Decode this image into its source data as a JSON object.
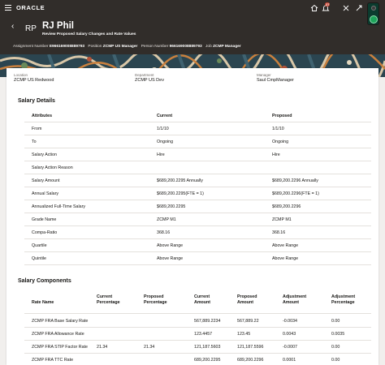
{
  "topbar": {
    "logo": "ORACLE",
    "notification_count": "27",
    "icons": [
      "menu-icon",
      "home-icon",
      "bell-icon",
      "tools-icon",
      "help-icon"
    ]
  },
  "header": {
    "initials": "RP",
    "name": "RJ Phil",
    "subtitle": "Review Proposed Salary Changes and Rate Values",
    "meta": [
      {
        "label": "Assignment Number",
        "value": "E966169008889793"
      },
      {
        "label": "Position",
        "value": "ZCMP US Manager"
      },
      {
        "label": "Person Number",
        "value": "966169008889793"
      },
      {
        "label": "Job",
        "value": "ZCMP Manager"
      }
    ]
  },
  "info": {
    "location_label": "Location",
    "location_value": "ZCMP US Redwood",
    "department_label": "Department",
    "department_value": "ZCMP US Dev",
    "manager_label": "Manager",
    "manager_value": "Saul CmpManager"
  },
  "salary_details": {
    "title": "Salary Details",
    "headers": {
      "attr": "Attributes",
      "current": "Current",
      "proposed": "Proposed"
    },
    "rows": [
      {
        "attr": "From",
        "current": "1/1/10",
        "proposed": "1/1/10"
      },
      {
        "attr": "To",
        "current": "Ongoing",
        "proposed": "Ongoing"
      },
      {
        "attr": "Salary Action",
        "current": "Hire",
        "proposed": "Hire"
      },
      {
        "attr": "Salary Action Reason",
        "current": "",
        "proposed": ""
      },
      {
        "attr": "Salary Amount",
        "current": "$689,200.2295 Annually",
        "proposed": "$689,200.2296 Annually"
      },
      {
        "attr": "Annual Salary",
        "current": "$689,200.2295(FTE = 1)",
        "proposed": "$689,200.2296(FTE = 1)"
      },
      {
        "attr": "Annualized Full-Time Salary",
        "current": "$689,200.2295",
        "proposed": "$689,200.2296"
      },
      {
        "attr": "Grade Name",
        "current": "ZCMP M1",
        "proposed": "ZCMP M1"
      },
      {
        "attr": "Compa-Ratio",
        "current": "368.16",
        "proposed": "368.16"
      },
      {
        "attr": "Quartile",
        "current": "Above Range",
        "proposed": "Above Range"
      },
      {
        "attr": "Quintile",
        "current": "Above Range",
        "proposed": "Above Range"
      }
    ]
  },
  "salary_components": {
    "title": "Salary Components",
    "headers": {
      "rate_name": "Rate Name",
      "current_pct": [
        "Current",
        "Percentage"
      ],
      "proposed_pct": [
        "Proposed",
        "Percentage"
      ],
      "current_amt": [
        "Current",
        "Amount"
      ],
      "proposed_amt": [
        "Proposed",
        "Amount"
      ],
      "adj_amt": [
        "Adjustment",
        "Amount"
      ],
      "adj_pct": [
        "Adjustment",
        "Percentage"
      ]
    },
    "rows": [
      {
        "rate_name": "ZCMP FRA Base Salary Rate",
        "current_pct": "",
        "proposed_pct": "",
        "current_amt": "567,889.2234",
        "proposed_amt": "567,889.22",
        "adj_amt": "-0.0034",
        "adj_pct": "0.00"
      },
      {
        "rate_name": "ZCMP FRA Allowance Rate",
        "current_pct": "",
        "proposed_pct": "",
        "current_amt": "123.4457",
        "proposed_amt": "123.45",
        "adj_amt": "0.0043",
        "adj_pct": "0.0035"
      },
      {
        "rate_name": "ZCMP FRA STIP Factor Rate",
        "current_pct": "21.34",
        "proposed_pct": "21.34",
        "current_amt": "121,187.5603",
        "proposed_amt": "121,187.5596",
        "adj_amt": "-0.0007",
        "adj_pct": "0.00"
      },
      {
        "rate_name": "ZCMP FRA TTC Rate",
        "current_pct": "",
        "proposed_pct": "",
        "current_amt": "689,200.2295",
        "proposed_amt": "689,200.2296",
        "adj_amt": "0.0001",
        "adj_pct": "0.00"
      }
    ]
  }
}
